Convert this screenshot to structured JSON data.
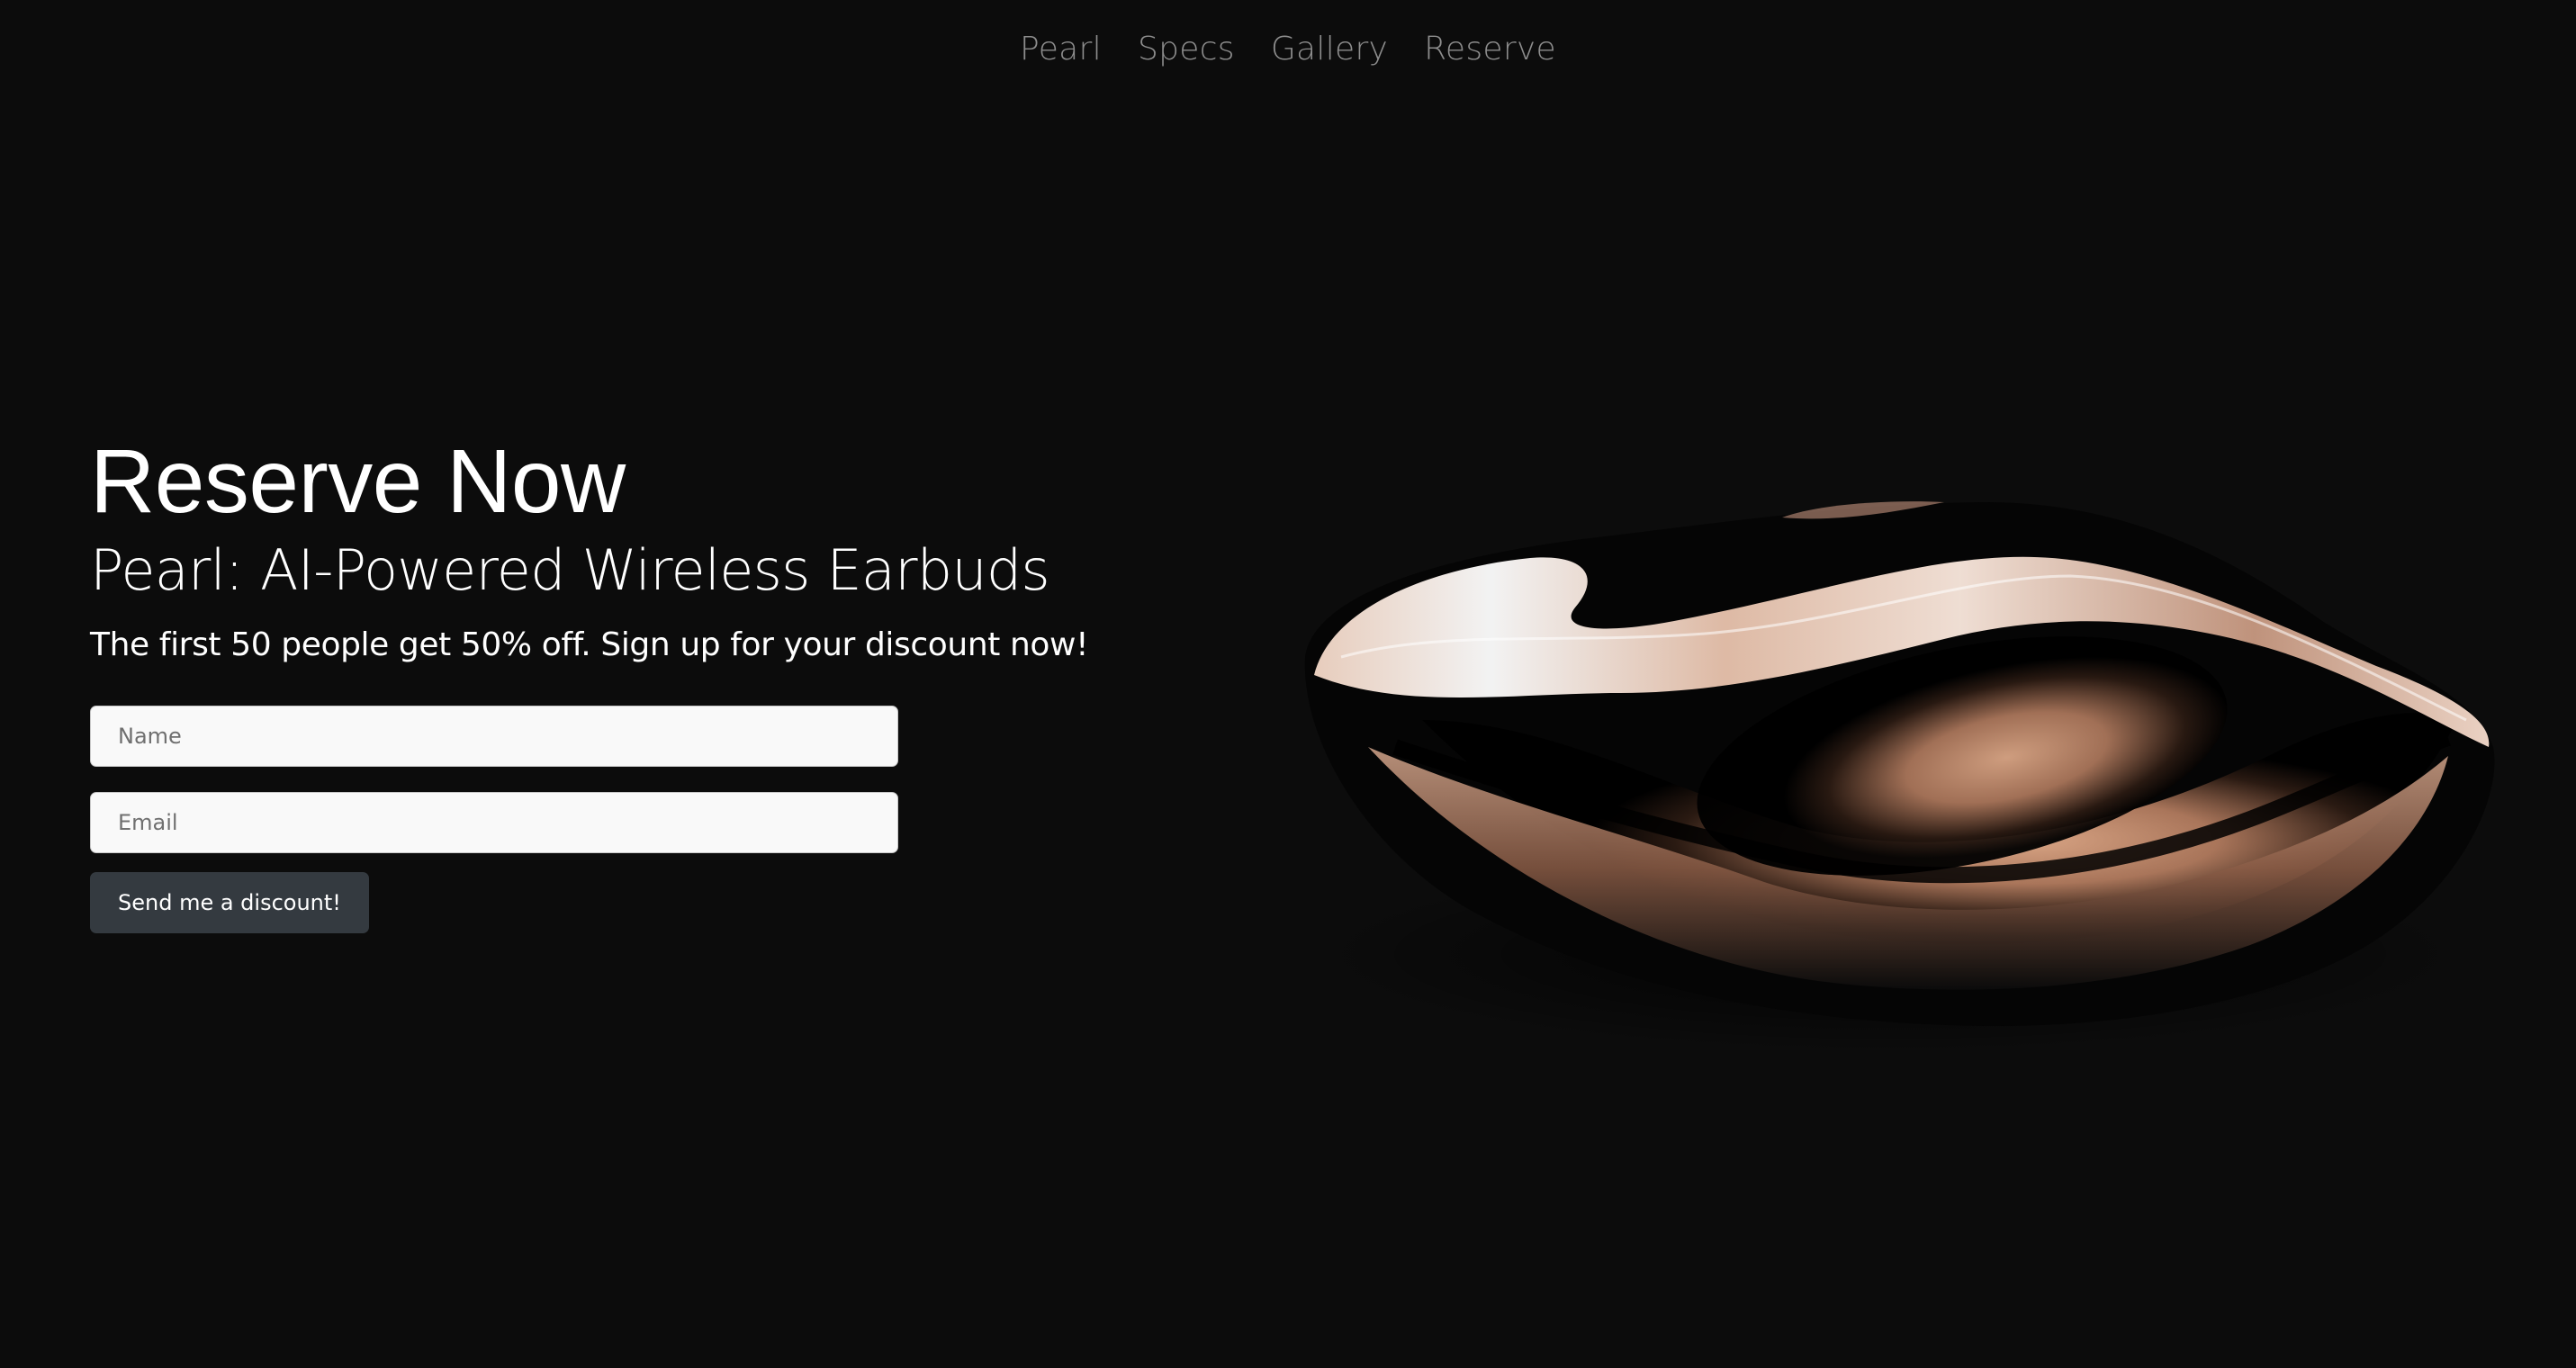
{
  "nav": {
    "items": [
      {
        "label": "Pearl"
      },
      {
        "label": "Specs"
      },
      {
        "label": "Gallery"
      },
      {
        "label": "Reserve"
      }
    ]
  },
  "hero": {
    "title": "Reserve Now",
    "subtitle": "Pearl: AI-Powered Wireless Earbuds",
    "copy": "The first 50 people get 50% off. Sign up for your discount now!"
  },
  "form": {
    "name_placeholder": "Name",
    "name_value": "",
    "email_placeholder": "Email",
    "email_value": "",
    "submit_label": "Send me a discount!"
  },
  "product_image": {
    "subject": "earbud-case-render"
  },
  "colors": {
    "background": "#0c0c0c",
    "nav_text": "#8e8e8e",
    "button_bg": "#343a40",
    "input_bg": "#f9f9f9",
    "product_accent": "#d9a585"
  }
}
